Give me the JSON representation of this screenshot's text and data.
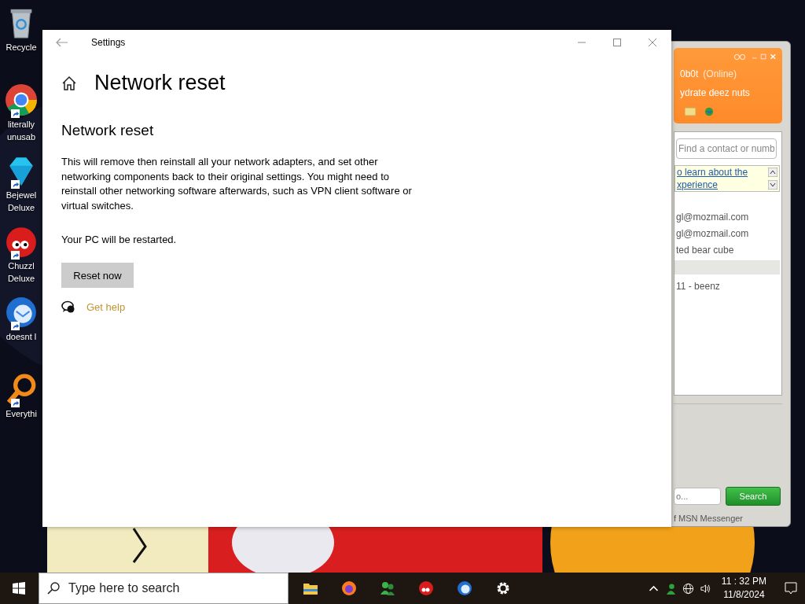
{
  "desktop_icons": [
    {
      "lines": [
        "Recycle"
      ],
      "kind": "recycle",
      "shortcut": false
    },
    {
      "lines": [
        "literally",
        "unusab"
      ],
      "kind": "chrome",
      "shortcut": true
    },
    {
      "lines": [
        "Bejewel",
        "Deluxe"
      ],
      "kind": "gem",
      "shortcut": true
    },
    {
      "lines": [
        "Chuzzl",
        "Deluxe"
      ],
      "kind": "fuzzball",
      "shortcut": true
    },
    {
      "lines": [
        "doesnt l"
      ],
      "kind": "bird",
      "shortcut": true
    },
    {
      "lines": [
        "Everythi"
      ],
      "kind": "magnifier",
      "shortcut": true
    }
  ],
  "messenger": {
    "display_name": "0b0t",
    "status": "(Online)",
    "personal_message": "ydrate deez nuts",
    "search_placeholder": "Find a contact or numb",
    "info_link": [
      "o learn about the",
      "xperience"
    ],
    "contacts": [
      {
        "text": "gl@mozmail.com",
        "kind": "contact"
      },
      {
        "text": "gl@mozmail.com",
        "kind": "contact"
      },
      {
        "text": "ted bear cube",
        "kind": "contact"
      },
      {
        "kind": "group"
      },
      {
        "text": "11 - beenz",
        "kind": "contact"
      }
    ],
    "web_search_placeholder": "o...",
    "search_button": "Search",
    "footer": "f MSN Messenger"
  },
  "settings": {
    "title": "Settings",
    "heading": "Network reset",
    "section_title": "Network reset",
    "description": "This will remove then reinstall all your network adapters, and set other networking components back to their original settings. You might need to reinstall other networking software afterwards, such as VPN client software or virtual switches.",
    "note": "Your PC will be restarted.",
    "button": "Reset now",
    "help_link": "Get help"
  },
  "taskbar": {
    "search_placeholder": "Type here to search",
    "apps": [
      {
        "kind": "folder"
      },
      {
        "kind": "firefox"
      },
      {
        "kind": "buddies"
      },
      {
        "kind": "fuzzball"
      },
      {
        "kind": "bird"
      },
      {
        "kind": "gear"
      }
    ],
    "time": "11 : 32 PM",
    "date": "11/8/2024"
  }
}
